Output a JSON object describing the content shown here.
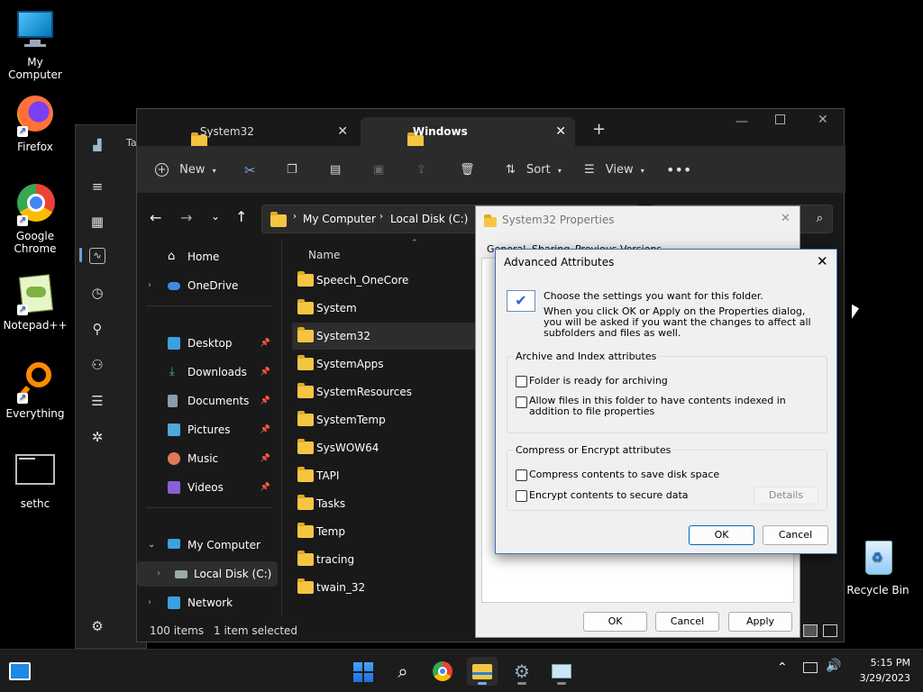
{
  "desktop": {
    "icons": [
      {
        "label": "My Computer"
      },
      {
        "label": "Firefox"
      },
      {
        "label": "Google Chrome"
      },
      {
        "label": "Notepad++"
      },
      {
        "label": "Everything"
      },
      {
        "label": "sethc"
      },
      {
        "label": "Recycle Bin"
      }
    ]
  },
  "bg_window": {
    "title_fragment": "Ta"
  },
  "explorer": {
    "tabs": [
      {
        "label": "System32"
      },
      {
        "label": "Windows"
      }
    ],
    "toolbar": {
      "new_label": "New",
      "sort_label": "Sort",
      "view_label": "View"
    },
    "breadcrumb": [
      "My Computer",
      "Local Disk (C:)"
    ],
    "nav": {
      "home": "Home",
      "onedrive": "OneDrive",
      "desktop": "Desktop",
      "downloads": "Downloads",
      "documents": "Documents",
      "pictures": "Pictures",
      "music": "Music",
      "videos": "Videos",
      "my_computer": "My Computer",
      "local_disk": "Local Disk (C:)",
      "network": "Network"
    },
    "column_name": "Name",
    "files": [
      "Speech_OneCore",
      "System",
      "System32",
      "SystemApps",
      "SystemResources",
      "SystemTemp",
      "SysWOW64",
      "TAPI",
      "Tasks",
      "Temp",
      "tracing",
      "twain_32"
    ],
    "status": {
      "count": "100 items",
      "selected": "1 item selected"
    }
  },
  "properties": {
    "title": "System32 Properties",
    "tab_general": "General",
    "tab_sharing": "Sharing",
    "tab_previous": "Previous Versions",
    "ok": "OK",
    "cancel": "Cancel",
    "apply": "Apply"
  },
  "advanced": {
    "title": "Advanced Attributes",
    "intro": "Choose the settings you want for this folder.",
    "intro_detail": "When you click OK or Apply on the Properties dialog, you will be asked if you want the changes to affect all subfolders and files as well.",
    "group1": "Archive and Index attributes",
    "archive": "Folder is ready for archiving",
    "index": "Allow files in this folder to have contents indexed in addition to file properties",
    "group2": "Compress or Encrypt attributes",
    "compress": "Compress contents to save disk space",
    "encrypt": "Encrypt contents to secure data",
    "details": "Details",
    "ok": "OK",
    "cancel": "Cancel"
  },
  "taskbar": {
    "time": "5:15 PM",
    "date": "3/29/2023"
  }
}
